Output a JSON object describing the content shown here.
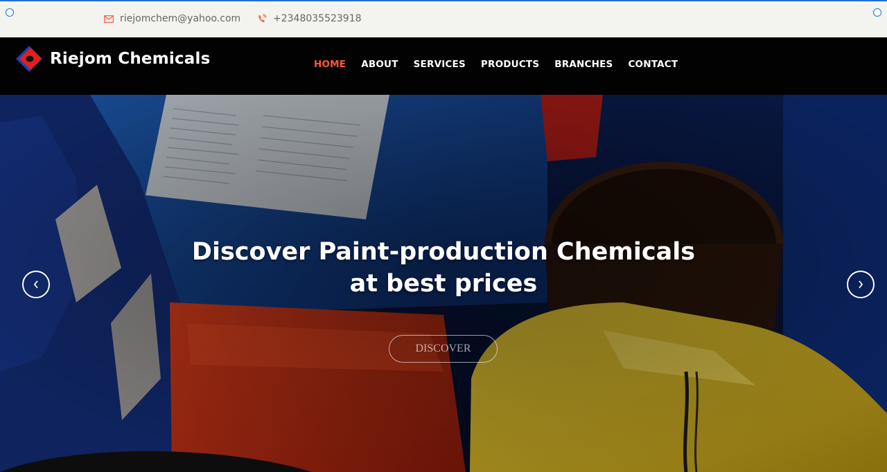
{
  "topbar": {
    "email": "riejomchem@yahoo.com",
    "phone": "+2348035523918",
    "email_icon": "envelope-icon",
    "phone_icon": "phone-icon"
  },
  "brand": {
    "name": "Riejom Chemicals",
    "logo_icon": "diamond-logo-icon"
  },
  "nav": {
    "items": [
      {
        "label": "HOME",
        "active": true
      },
      {
        "label": "ABOUT"
      },
      {
        "label": "SERVICES"
      },
      {
        "label": "PRODUCTS"
      },
      {
        "label": "BRANCHES"
      },
      {
        "label": "CONTACT"
      }
    ]
  },
  "hero": {
    "headline_line1": "Discover Paint-production Chemicals",
    "headline_line2": "at best prices",
    "cta_label": "DISCOVER",
    "prev_icon": "chevron-left-icon",
    "next_icon": "chevron-right-icon"
  },
  "colors": {
    "accent": "#ff5a3a",
    "header_bg": "#020202",
    "topbar_bg": "#f3f3ef",
    "selection": "#1f6fd1"
  }
}
